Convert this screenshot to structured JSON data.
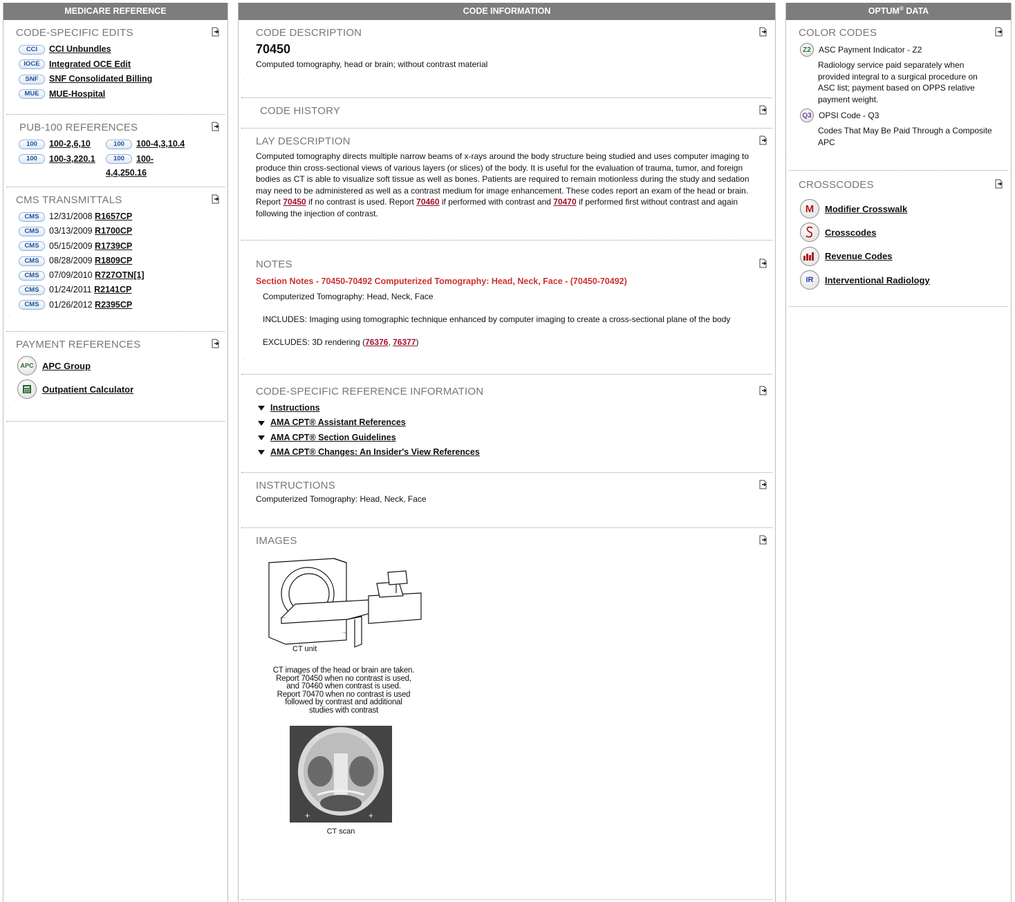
{
  "left": {
    "header": "MEDICARE REFERENCE",
    "code_edits": {
      "title": "CODE-SPECIFIC EDITS",
      "items": [
        {
          "badge": "CCI",
          "label": "CCI Unbundles"
        },
        {
          "badge": "IOCE",
          "label": "Integrated OCE Edit"
        },
        {
          "badge": "SNF",
          "label": "SNF Consolidated Billing"
        },
        {
          "badge": "MUE",
          "label": "MUE-Hospital"
        }
      ]
    },
    "pub100": {
      "title": "PUB-100 REFERENCES",
      "badge": "100",
      "items": [
        "100-2,6,10",
        "100-4,3,10.4",
        "100-3,220.1",
        "100-4,4,250.16"
      ]
    },
    "cms": {
      "title": "CMS TRANSMITTALS",
      "badge": "CMS",
      "items": [
        {
          "date": "12/31/2008",
          "code": "R1657CP"
        },
        {
          "date": "03/13/2009",
          "code": "R1700CP"
        },
        {
          "date": "05/15/2009",
          "code": "R1739CP"
        },
        {
          "date": "08/28/2009",
          "code": "R1809CP"
        },
        {
          "date": "07/09/2010",
          "code": "R727OTN[1]"
        },
        {
          "date": "01/24/2011",
          "code": "R2141CP"
        },
        {
          "date": "01/26/2012",
          "code": "R2395CP"
        }
      ]
    },
    "payment": {
      "title": "PAYMENT REFERENCES",
      "apc_badge": "APC",
      "apc_label": "APC Group",
      "calc_label": "Outpatient Calculator"
    }
  },
  "mid": {
    "header": "CODE INFORMATION",
    "desc": {
      "title": "CODE DESCRIPTION",
      "code": "70450",
      "text": "Computed tomography, head or brain; without contrast material"
    },
    "history": {
      "title": "CODE HISTORY"
    },
    "lay": {
      "title": "LAY DESCRIPTION",
      "text1": "Computed tomography directs multiple narrow beams of x-rays around the body structure being studied and uses computer imaging to produce thin cross-sectional views of various layers (or slices) of the body. It is useful for the evaluation of trauma, tumor, and foreign bodies as CT is able to visualize soft tissue as well as bones. Patients are required to remain motionless during the study and sedation may need to be administered as well as a contrast medium for image enhancement. These codes report an exam of the head or brain. Report ",
      "link1": "70450",
      "text2": " if no contrast is used. Report ",
      "link2": "70460",
      "text3": " if performed with contrast and ",
      "link3": "70470",
      "text4": " if performed first without contrast and again following the injection of contrast."
    },
    "notes": {
      "title": "NOTES",
      "section_title": "Section Notes - 70450-70492 Computerized Tomography: Head, Neck, Face - (70450-70492)",
      "line1": "Computerized Tomography: Head, Neck, Face",
      "line2": "INCLUDES: Imaging using tomographic technique enhanced by computer imaging to create a cross-sectional plane of the body",
      "excl_prefix": "EXCLUDES: 3D rendering (",
      "excl_link1": "76376",
      "excl_sep": ", ",
      "excl_link2": "76377",
      "excl_suffix": ")"
    },
    "refinfo": {
      "title": "CODE-SPECIFIC REFERENCE INFORMATION",
      "items": [
        "Instructions",
        "AMA CPT® Assistant References",
        "AMA CPT® Section Guidelines",
        "AMA CPT® Changes: An Insider's View References"
      ]
    },
    "instructions": {
      "title": "INSTRUCTIONS",
      "text": "Computerized Tomography: Head, Neck, Face"
    },
    "images": {
      "title": "IMAGES",
      "ct_unit_label": "CT unit",
      "caption_lines": [
        "CT images of the head or brain are taken.",
        "Report 70450 when no contrast is used,",
        "and 70460 when contrast is used.",
        "Report 70470 when no contrast is used",
        "followed by contrast and additional",
        "studies with contrast"
      ],
      "ct_scan_label": "CT scan"
    }
  },
  "right": {
    "header_pre": "OPTUM",
    "header_sup": "®",
    "header_post": " DATA",
    "color_codes": {
      "title": "COLOR CODES",
      "items": [
        {
          "badge": "Z2",
          "label": "ASC Payment Indicator - Z2",
          "desc": "Radiology service paid separately when provided integral to a surgical procedure on ASC list; payment based on OPPS relative payment weight.",
          "color": "#2b7a2b"
        },
        {
          "badge": "Q3",
          "label": "OPSI Code - Q3",
          "desc": "Codes That May Be Paid Through a Composite APC",
          "color": "#6b3aa0"
        }
      ]
    },
    "crosscodes": {
      "title": "CROSSCODES",
      "items": [
        {
          "icon": "M",
          "label": "Modifier Crosswalk"
        },
        {
          "icon": "S",
          "label": "Crosscodes"
        },
        {
          "icon": "ill",
          "label": "Revenue Codes"
        },
        {
          "icon": "IR",
          "label": "Interventional Radiology"
        }
      ]
    }
  },
  "colors": {
    "header_bg": "#7d7d7d",
    "section_title": "#777777",
    "link_red": "#a0102a",
    "notes_red": "#cc3333"
  }
}
